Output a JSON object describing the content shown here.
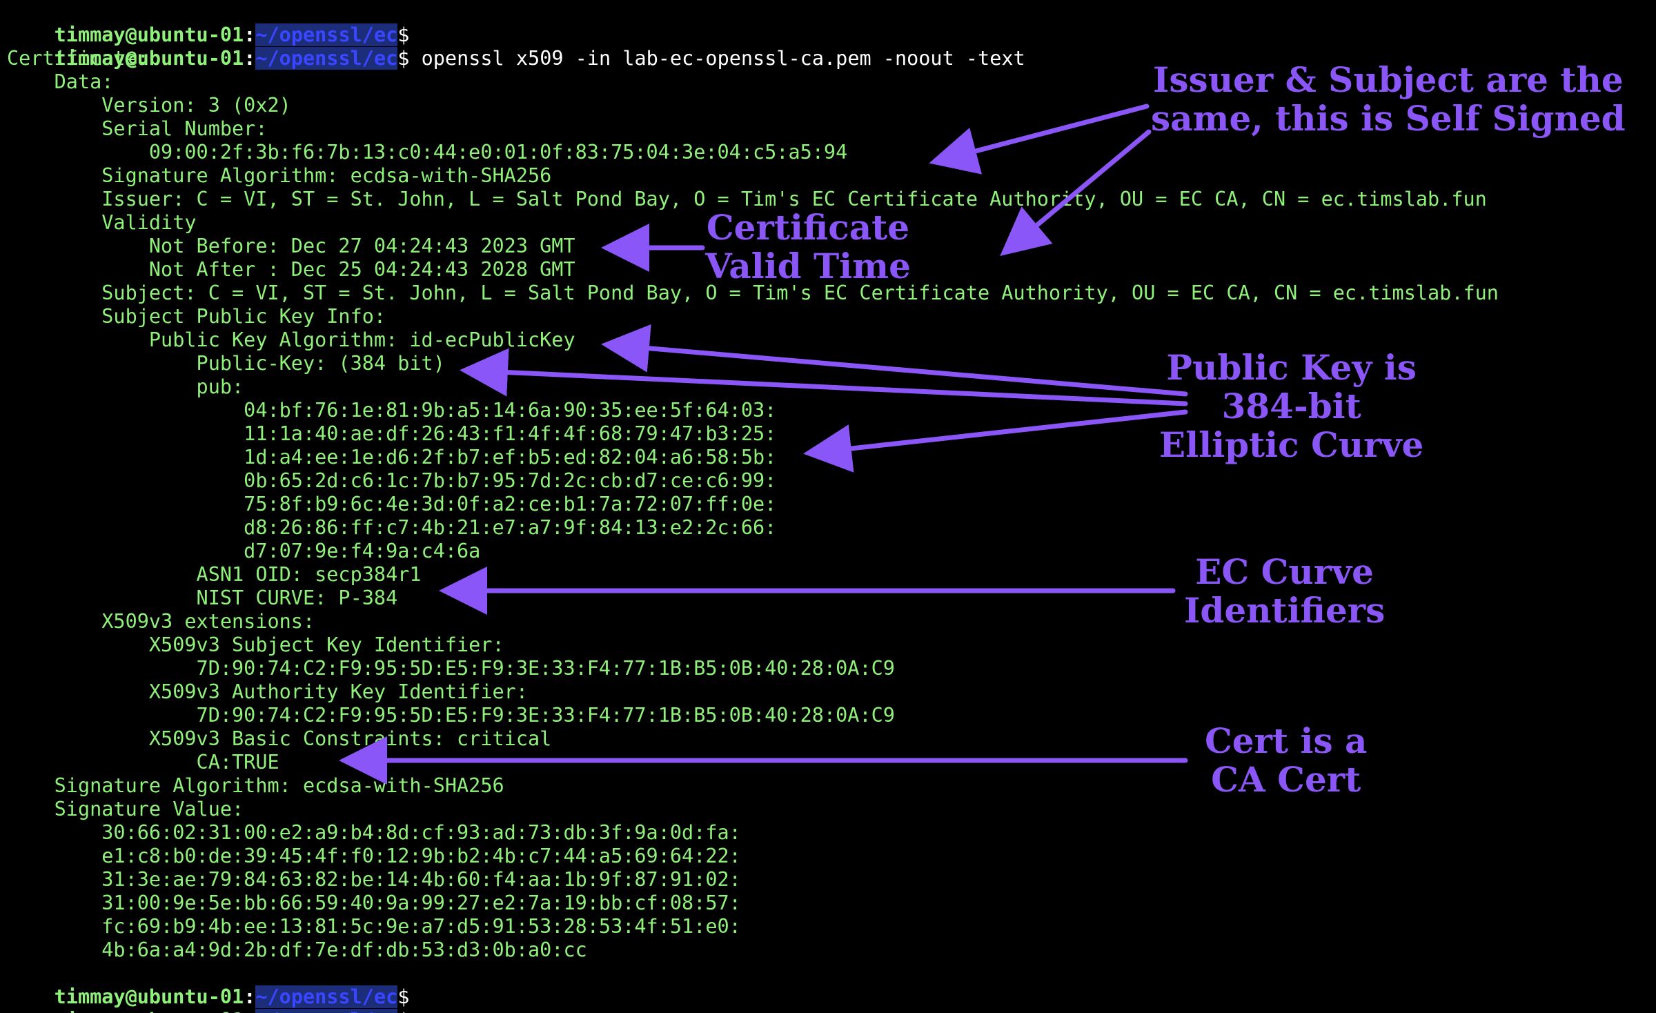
{
  "terminal": {
    "user_host": "timmay@ubuntu-01",
    "path": "~/openssl/ec",
    "prompt_symbol": "$",
    "command": "openssl x509 -in lab-ec-openssl-ca.pem -noout -text",
    "output": [
      "Certificate:",
      "    Data:",
      "        Version: 3 (0x2)",
      "        Serial Number:",
      "            09:00:2f:3b:f6:7b:13:c0:44:e0:01:0f:83:75:04:3e:04:c5:a5:94",
      "        Signature Algorithm: ecdsa-with-SHA256",
      "        Issuer: C = VI, ST = St. John, L = Salt Pond Bay, O = Tim's EC Certificate Authority, OU = EC CA, CN = ec.timslab.fun",
      "        Validity",
      "            Not Before: Dec 27 04:24:43 2023 GMT",
      "            Not After : Dec 25 04:24:43 2028 GMT",
      "        Subject: C = VI, ST = St. John, L = Salt Pond Bay, O = Tim's EC Certificate Authority, OU = EC CA, CN = ec.timslab.fun",
      "        Subject Public Key Info:",
      "            Public Key Algorithm: id-ecPublicKey",
      "                Public-Key: (384 bit)",
      "                pub:",
      "                    04:bf:76:1e:81:9b:a5:14:6a:90:35:ee:5f:64:03:",
      "                    11:1a:40:ae:df:26:43:f1:4f:4f:68:79:47:b3:25:",
      "                    1d:a4:ee:1e:d6:2f:b7:ef:b5:ed:82:04:a6:58:5b:",
      "                    0b:65:2d:c6:1c:7b:b7:95:7d:2c:cb:d7:ce:c6:99:",
      "                    75:8f:b9:6c:4e:3d:0f:a2:ce:b1:7a:72:07:ff:0e:",
      "                    d8:26:86:ff:c7:4b:21:e7:a7:9f:84:13:e2:2c:66:",
      "                    d7:07:9e:f4:9a:c4:6a",
      "                ASN1 OID: secp384r1",
      "                NIST CURVE: P-384",
      "        X509v3 extensions:",
      "            X509v3 Subject Key Identifier:",
      "                7D:90:74:C2:F9:95:5D:E5:F9:3E:33:F4:77:1B:B5:0B:40:28:0A:C9",
      "            X509v3 Authority Key Identifier:",
      "                7D:90:74:C2:F9:95:5D:E5:F9:3E:33:F4:77:1B:B5:0B:40:28:0A:C9",
      "            X509v3 Basic Constraints: critical",
      "                CA:TRUE",
      "    Signature Algorithm: ecdsa-with-SHA256",
      "    Signature Value:",
      "        30:66:02:31:00:e2:a9:b4:8d:cf:93:ad:73:db:3f:9a:0d:fa:",
      "        e1:c8:b0:de:39:45:4f:f0:12:9b:b2:4b:c7:44:a5:69:64:22:",
      "        31:3e:ae:79:84:63:82:be:14:4b:60:f4:aa:1b:9f:87:91:02:",
      "        31:00:9e:5e:bb:66:59:40:9a:99:27:e2:7a:19:bb:cf:08:57:",
      "        fc:69:b9:4b:ee:13:81:5c:9e:a7:d5:91:53:28:53:4f:51:e0:",
      "        4b:6a:a4:9d:2b:df:7e:df:db:53:d3:0b:a0:cc"
    ]
  },
  "annotations": {
    "self_signed": [
      "Issuer & Subject are the",
      "same, this is Self Signed"
    ],
    "valid_time": [
      "Certificate",
      "Valid Time"
    ],
    "public_key": [
      "Public Key is",
      "384-bit",
      "Elliptic Curve"
    ],
    "curve_ids": [
      "EC Curve",
      "Identifiers"
    ],
    "ca_cert": [
      "Cert is a",
      "CA Cert"
    ]
  },
  "colors": {
    "background": "#000000",
    "terminal_text": "#8ff07a",
    "annotation": "#8a56f7",
    "path": "#3a46ff"
  }
}
